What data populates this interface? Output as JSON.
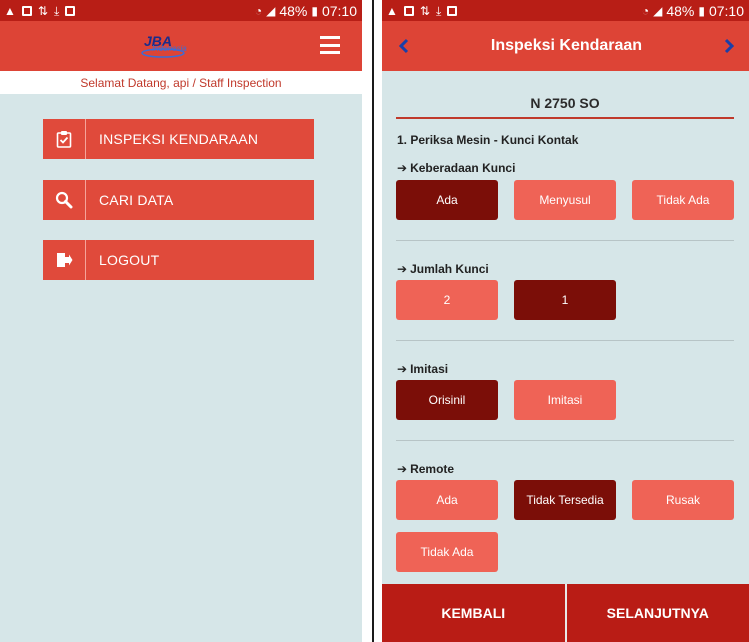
{
  "status_bar": {
    "battery": "48%",
    "time": "07:10"
  },
  "left_screen": {
    "logo": {
      "brand": "JBA",
      "tagline": "Indonesia"
    },
    "welcome": "Selamat Datang, api / Staff Inspection",
    "menu": [
      {
        "icon": "clipboard-check-icon",
        "label": "INSPEKSI KENDARAAN"
      },
      {
        "icon": "search-icon",
        "label": "CARI DATA"
      },
      {
        "icon": "logout-icon",
        "label": "LOGOUT"
      }
    ]
  },
  "right_screen": {
    "title": "Inspeksi Kendaraan",
    "plate": "N 2750 SO",
    "section": "1. Periksa Mesin - Kunci Kontak",
    "questions": [
      {
        "label": "Keberadaan Kunci",
        "options": [
          "Ada",
          "Menyusul",
          "Tidak Ada"
        ],
        "selected": "Ada"
      },
      {
        "label": "Jumlah Kunci",
        "options": [
          "2",
          "1"
        ],
        "selected": "1"
      },
      {
        "label": "Imitasi",
        "options": [
          "Orisinil",
          "Imitasi"
        ],
        "selected": "Orisinil"
      },
      {
        "label": "Remote",
        "options": [
          "Ada",
          "Tidak Tersedia",
          "Rusak",
          "Tidak Ada"
        ],
        "selected": "Tidak Tersedia"
      }
    ],
    "footer": {
      "back": "KEMBALI",
      "next": "SELANJUTNYA"
    }
  },
  "colors": {
    "header": "#dd4436",
    "status_bar": "#b81e16",
    "selected": "#7b0e08",
    "unselected": "#ef6356",
    "background": "#d6e6e8"
  }
}
